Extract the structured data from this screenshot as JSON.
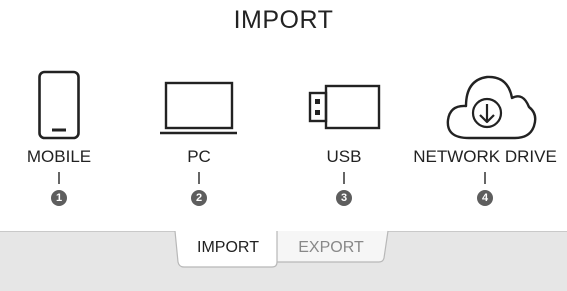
{
  "page": {
    "title": "IMPORT"
  },
  "sources": [
    {
      "label": "MOBILE",
      "badge": "1",
      "icon": "smartphone-icon"
    },
    {
      "label": "PC",
      "badge": "2",
      "icon": "laptop-icon"
    },
    {
      "label": "USB",
      "badge": "3",
      "icon": "usb-drive-icon"
    },
    {
      "label": "NETWORK DRIVE",
      "badge": "4",
      "icon": "cloud-download-icon"
    }
  ],
  "tabs": [
    {
      "label": "IMPORT",
      "active": true
    },
    {
      "label": "EXPORT",
      "active": false
    }
  ],
  "colors": {
    "badge": "#5e5e5e",
    "panel": "#e6e6e6",
    "active_tab": "#ffffff",
    "inactive_tab_text": "#888888"
  }
}
